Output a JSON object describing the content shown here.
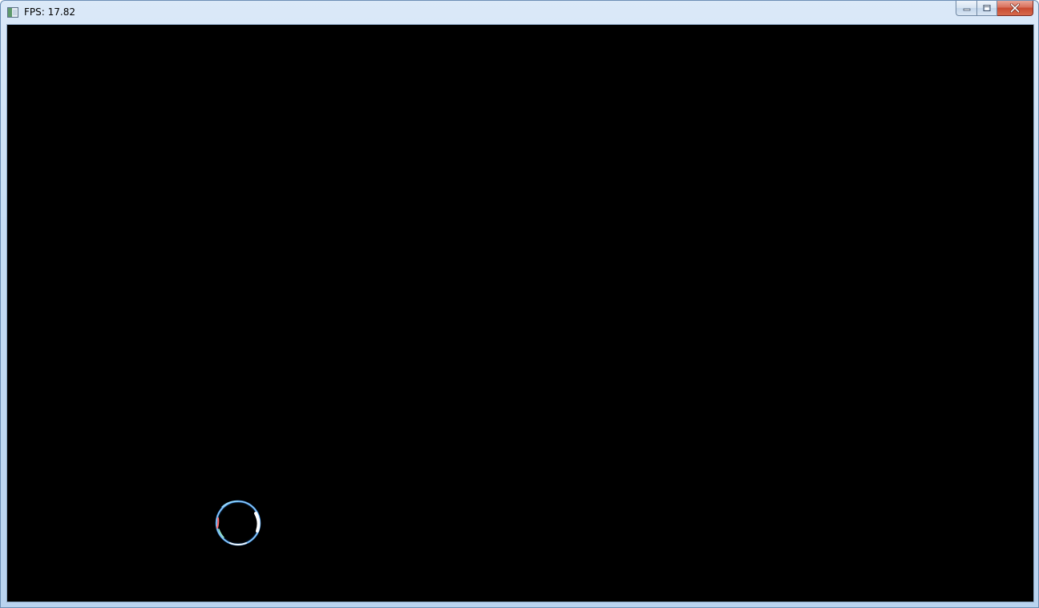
{
  "window": {
    "title": "FPS: 17.82",
    "icon": "app-window-icon"
  },
  "caption_buttons": {
    "minimize_icon": "minimize-icon",
    "maximize_icon": "restore-icon",
    "close_icon": "close-icon"
  },
  "canvas": {
    "background": "#000000",
    "object": "ring-bubble",
    "ring_colors": [
      "#4aa8ff",
      "#ffffff",
      "#ff6a6a",
      "#8fd8ff"
    ]
  }
}
